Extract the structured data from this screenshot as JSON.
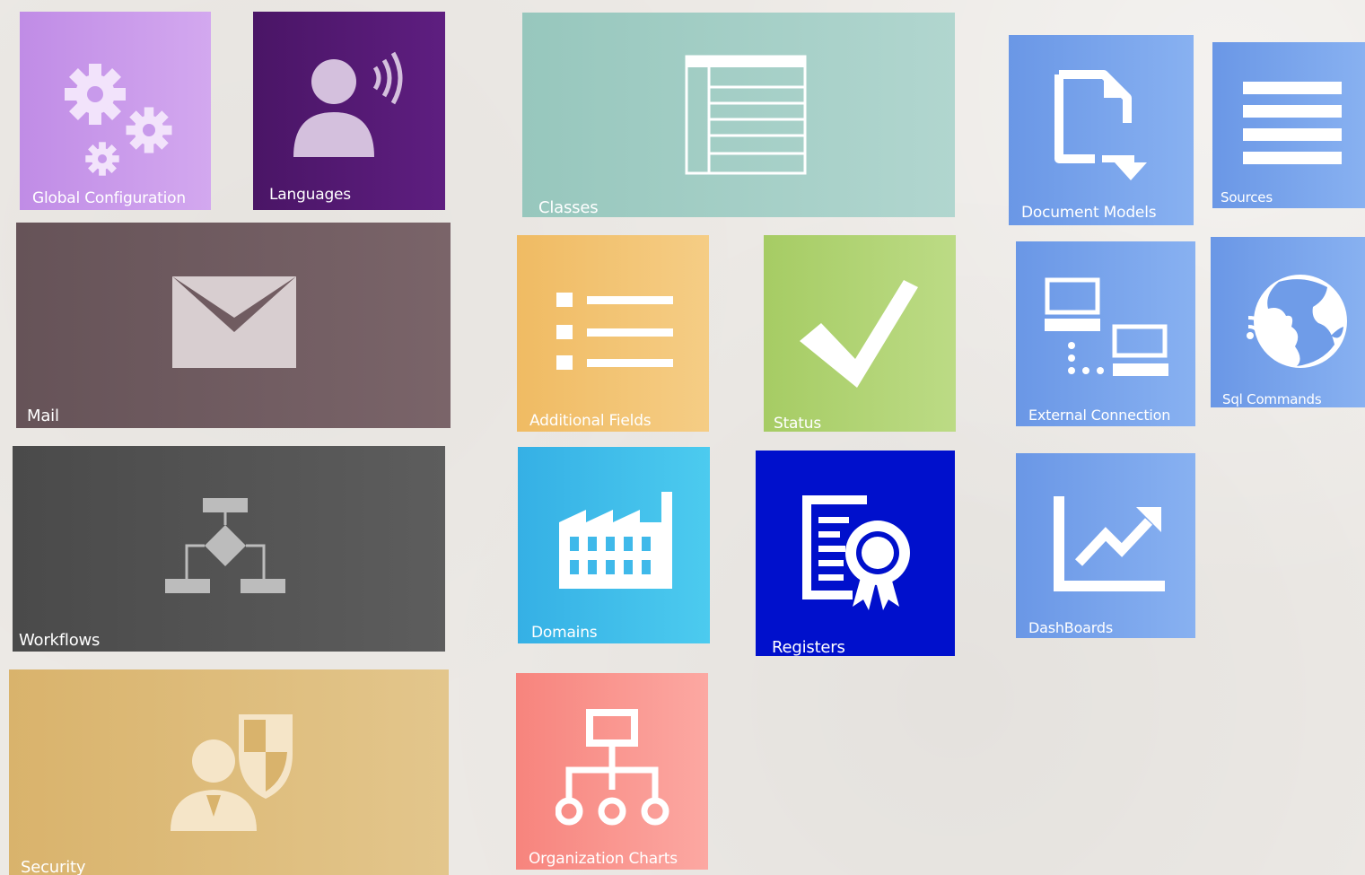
{
  "tiles": {
    "global_configuration": {
      "label": "Global Configuration",
      "icon": "gears-icon"
    },
    "languages": {
      "label": "Languages",
      "icon": "speaking-person-icon"
    },
    "classes": {
      "label": "Classes",
      "icon": "table-icon"
    },
    "document_models": {
      "label": "Document Models",
      "icon": "document-arrow-icon"
    },
    "sources": {
      "label": "Sources",
      "icon": "list-lines-icon"
    },
    "mail": {
      "label": "Mail",
      "icon": "envelope-icon"
    },
    "additional_fields": {
      "label": "Additional Fields",
      "icon": "bulleted-list-icon"
    },
    "status": {
      "label": "Status",
      "icon": "checkmark-icon"
    },
    "external_connection": {
      "label": "External Connection",
      "icon": "network-computers-icon"
    },
    "sql_commands": {
      "label": "Sql Commands",
      "icon": "globe-signal-icon"
    },
    "workflows": {
      "label": "Workflows",
      "icon": "flowchart-icon"
    },
    "domains": {
      "label": "Domains",
      "icon": "factory-icon"
    },
    "registers": {
      "label": "Registers",
      "icon": "certificate-icon"
    },
    "dashboards": {
      "label": "DashBoards",
      "icon": "line-chart-icon"
    },
    "security": {
      "label": "Security",
      "icon": "user-shield-icon"
    },
    "organization_charts": {
      "label": "Organization Charts",
      "icon": "org-chart-icon"
    }
  }
}
